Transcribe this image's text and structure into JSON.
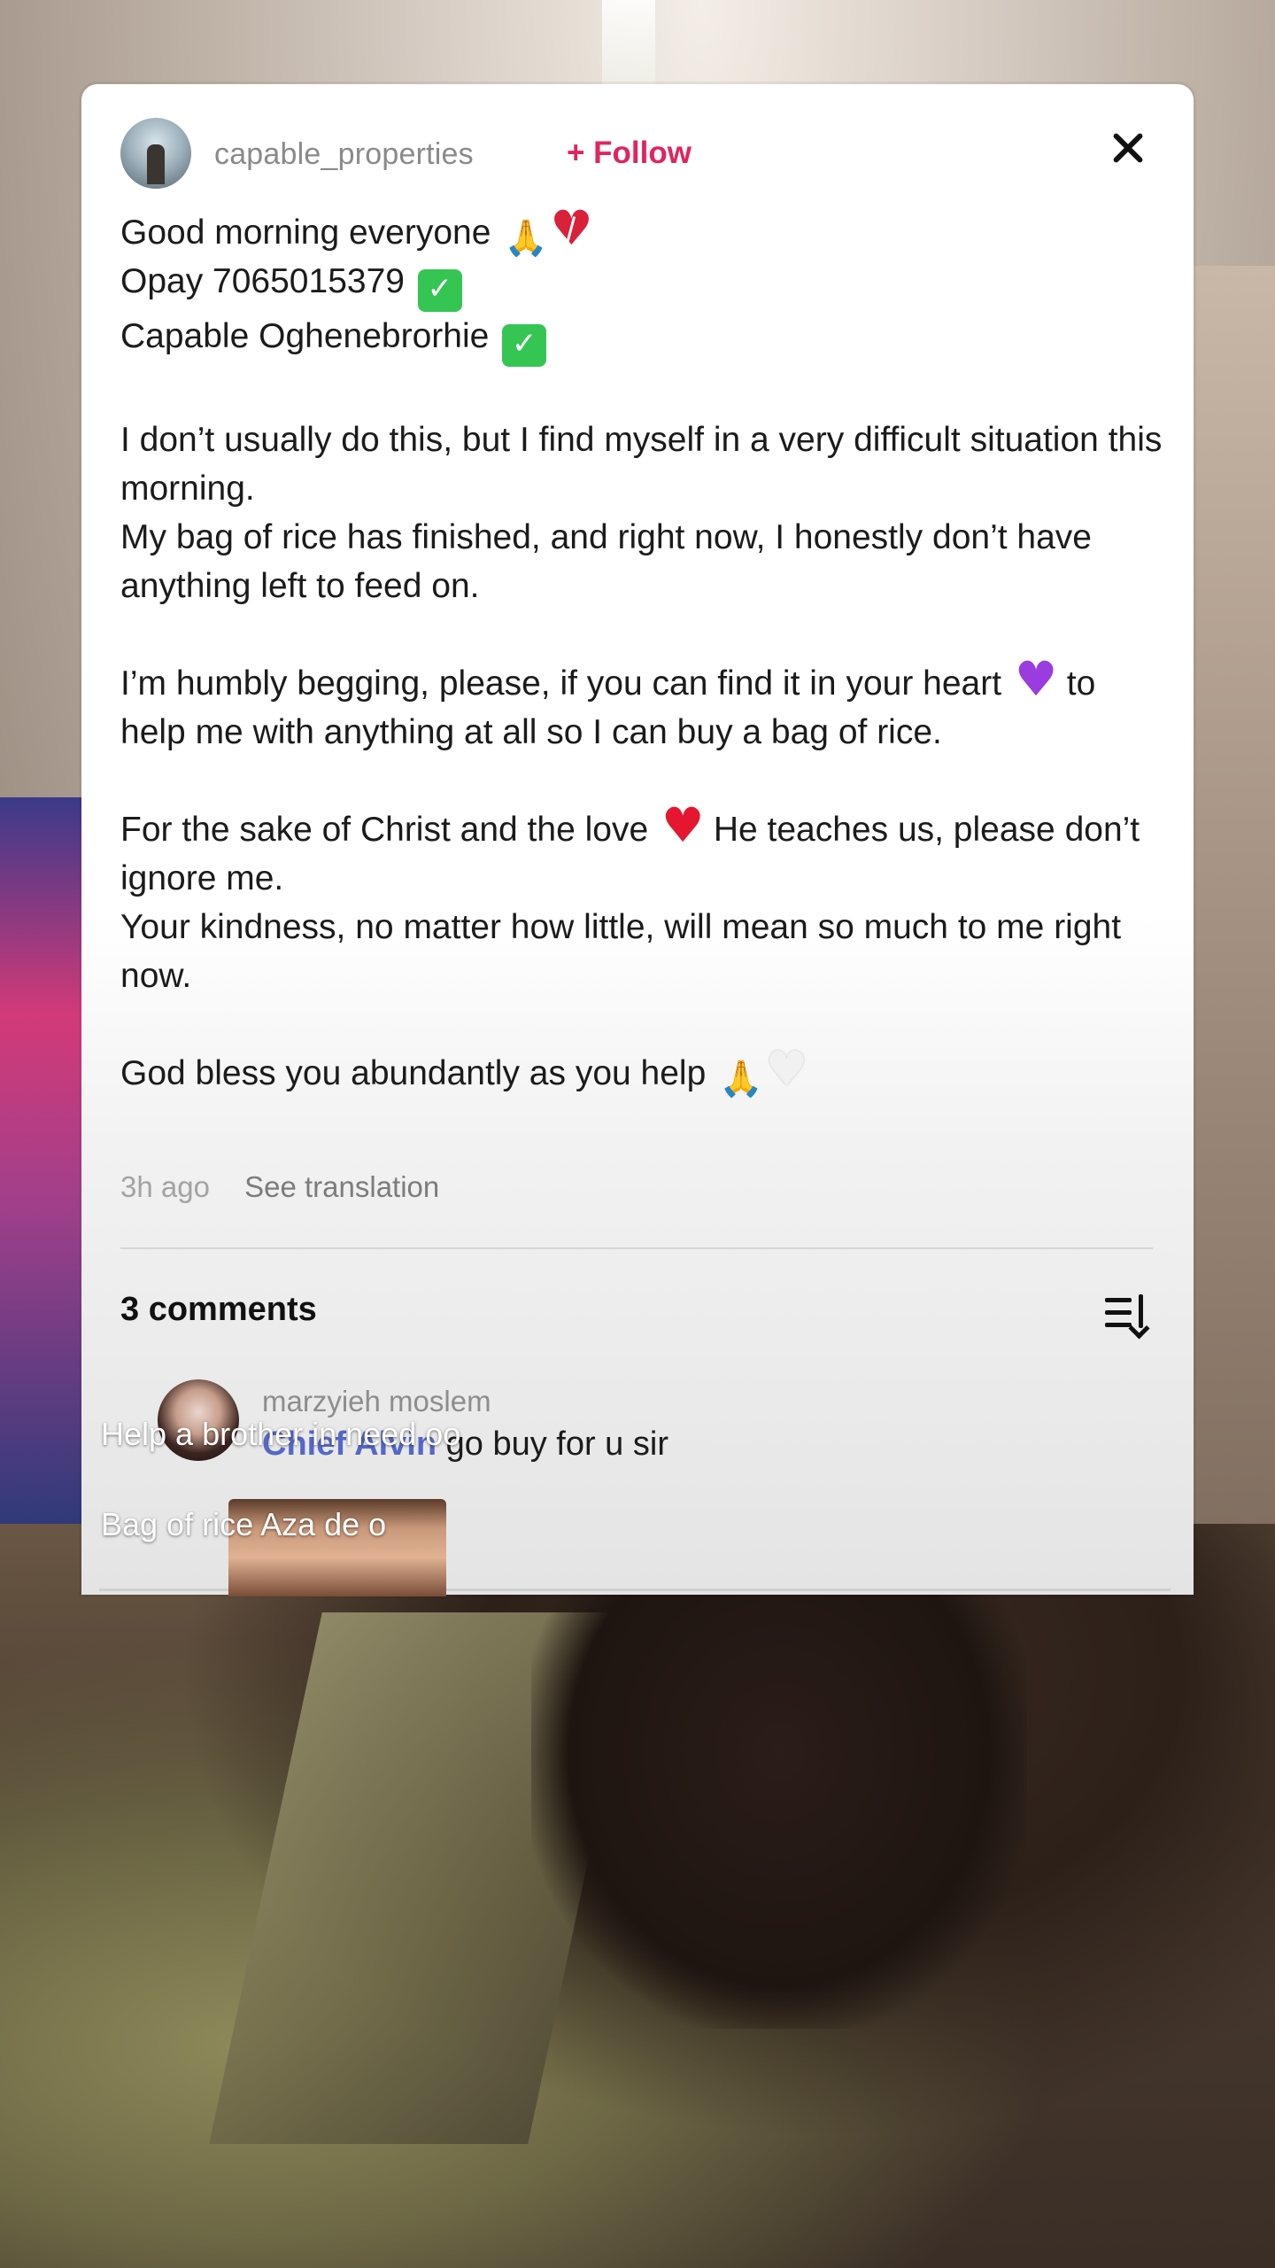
{
  "post": {
    "username": "capable_properties",
    "follow_label": "+ Follow",
    "lines_block1": [
      "Good morning everyone",
      "Opay 7065015379",
      "Capable Oghenebrorhie"
    ],
    "para2": "I don’t usually do this, but I find myself in a very difficult situation this morning.",
    "para2b": "My bag of rice has finished, and right now, I honestly don’t have anything left to feed on.",
    "para3a": "I’m humbly begging, please, if you can find it in your heart",
    "para3b": "to help me with anything at all so I can buy a bag of rice.",
    "para4a": "For the sake of Christ and the love",
    "para4b": "He teaches us, please don’t ignore me.",
    "para4c": "Your kindness, no matter how little, will mean so much to me right now.",
    "para5": "God bless you abundantly as you help",
    "time_ago": "3h ago",
    "see_translation": "See translation"
  },
  "comments": {
    "count_label": "3 comments",
    "items": [
      {
        "name": "marzyieh moslem",
        "mention": "Chief Alvin",
        "text": "go buy for u sir"
      }
    ]
  },
  "captions": [
    "Help a brother in need oo",
    "Bag of rice Aza de o"
  ],
  "colors": {
    "follow": "#e0245e",
    "mention": "#5568c9"
  },
  "icons": [
    "close-icon",
    "sort-icon",
    "pray-emoji",
    "broken-heart-emoji",
    "check-emoji",
    "purple-heart-emoji",
    "red-heart-emoji",
    "white-heart-emoji"
  ]
}
